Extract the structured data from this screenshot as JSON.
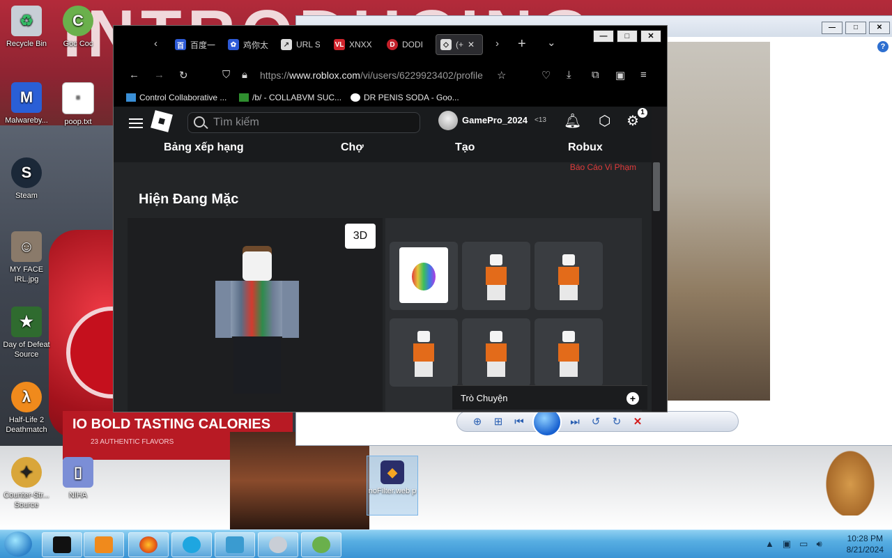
{
  "desktop": {
    "icons": [
      {
        "label": "Recycle Bin"
      },
      {
        "label": "Goc Coc"
      },
      {
        "label": "Malwareby..."
      },
      {
        "label": "poop.txt"
      },
      {
        "label": "Steam"
      },
      {
        "label": "MY FACE IRL.jpg"
      },
      {
        "label": "Day of Defeat Source"
      },
      {
        "label": "Half-Life 2 Deathmatch"
      },
      {
        "label": "Counter-Str... Source"
      },
      {
        "label": "NIHA"
      },
      {
        "label": "noFilter.web p"
      }
    ],
    "wallpaper_text": "IO BOLD TASTING CALORIES",
    "wallpaper_sub": "23 AUTHENTIC FLAVORS"
  },
  "browser": {
    "tabs": [
      {
        "label": "百度一"
      },
      {
        "label": "鸡你太"
      },
      {
        "label": "URL S"
      },
      {
        "label": "XNXX"
      },
      {
        "label": "DODI"
      },
      {
        "label": "(+"
      }
    ],
    "url_prefix": "https://",
    "url_host": "www.roblox.com",
    "url_path": "/vi/users/6229923402/profile",
    "bookmarks": [
      {
        "label": "Control Collaborative ..."
      },
      {
        "label": "/b/ - COLLABVM SUC..."
      },
      {
        "label": "DR PENIS SODA - Goo..."
      }
    ]
  },
  "roblox": {
    "search_placeholder": "Tìm kiếm",
    "username": "GamePro_2024",
    "age_badge": "<13",
    "notification_count": "1",
    "nav": [
      "Bảng xếp hạng",
      "Chợ",
      "Tạo",
      "Robux"
    ],
    "report_link": "Báo Cáo Vi Phạm",
    "section_title": "Hiện Đang Mặc",
    "view_3d": "3D",
    "chat_label": "Trò Chuyện",
    "chat_plus": "+"
  },
  "taskbar": {
    "time": "10:28 PM",
    "date": "8/21/2024"
  },
  "colors": {
    "roblox_bg": "#232527",
    "report_red": "#e03b3b",
    "taskbar_blue": "#57aee2"
  }
}
